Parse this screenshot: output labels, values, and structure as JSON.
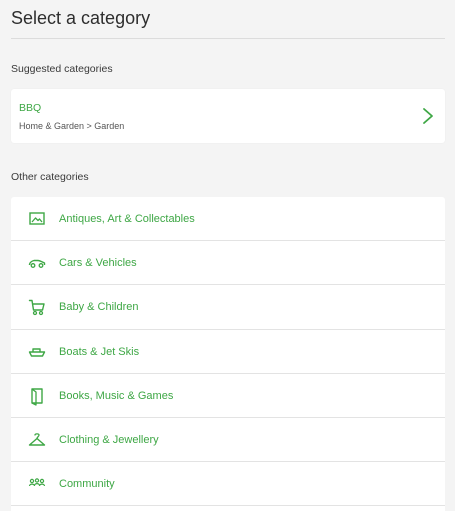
{
  "page": {
    "title": "Select a category"
  },
  "suggested": {
    "heading": "Suggested categories",
    "item": {
      "name": "BBQ",
      "path": "Home & Garden > Garden",
      "chevron_icon": "chevron-right-icon"
    }
  },
  "other": {
    "heading": "Other categories",
    "items": [
      {
        "label": "Antiques, Art & Collectables",
        "icon": "picture-frame-icon"
      },
      {
        "label": "Cars & Vehicles",
        "icon": "car-icon"
      },
      {
        "label": "Baby & Children",
        "icon": "stroller-icon"
      },
      {
        "label": "Boats & Jet Skis",
        "icon": "boat-icon"
      },
      {
        "label": "Books, Music & Games",
        "icon": "book-icon"
      },
      {
        "label": "Clothing & Jewellery",
        "icon": "hanger-icon"
      },
      {
        "label": "Community",
        "icon": "people-icon"
      }
    ]
  },
  "colors": {
    "accent": "#3ea745",
    "background": "#f4f4f4",
    "card": "#ffffff",
    "divider": "#e3e3e3"
  }
}
